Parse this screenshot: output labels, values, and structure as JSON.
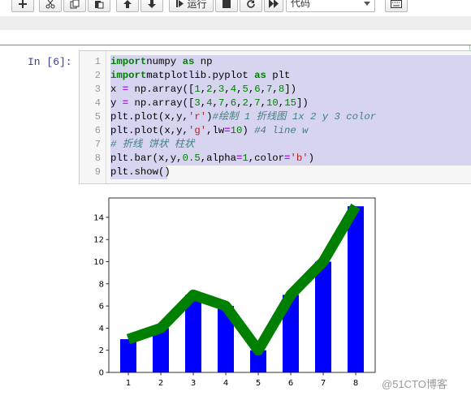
{
  "toolbar": {
    "run_label": "运行",
    "cell_type": "代码"
  },
  "cell": {
    "prompt": "In  [6]:",
    "lines": [
      {
        "no": "1",
        "tokens": [
          [
            "kw",
            "import"
          ],
          [
            "",
            "numpy "
          ],
          [
            "kw",
            "as"
          ],
          [
            "",
            " np"
          ]
        ]
      },
      {
        "no": "2",
        "tokens": [
          [
            "kw",
            "import"
          ],
          [
            "",
            "matplotlib.pyplot "
          ],
          [
            "kw",
            "as"
          ],
          [
            "",
            " plt"
          ]
        ]
      },
      {
        "no": "3",
        "tokens": [
          [
            "",
            "x "
          ],
          [
            "op",
            "="
          ],
          [
            "",
            " np.array(["
          ],
          [
            "num",
            "1"
          ],
          [
            "",
            ","
          ],
          [
            "num",
            "2"
          ],
          [
            "",
            ","
          ],
          [
            "num",
            "3"
          ],
          [
            "",
            ","
          ],
          [
            "num",
            "4"
          ],
          [
            "",
            ","
          ],
          [
            "num",
            "5"
          ],
          [
            "",
            ","
          ],
          [
            "num",
            "6"
          ],
          [
            "",
            ","
          ],
          [
            "num",
            "7"
          ],
          [
            "",
            ","
          ],
          [
            "num",
            "8"
          ],
          [
            "",
            "])"
          ]
        ]
      },
      {
        "no": "4",
        "tokens": [
          [
            "",
            "y "
          ],
          [
            "op",
            "="
          ],
          [
            "",
            " np.array(["
          ],
          [
            "num",
            "3"
          ],
          [
            "",
            ","
          ],
          [
            "num",
            "4"
          ],
          [
            "",
            ","
          ],
          [
            "num",
            "7"
          ],
          [
            "",
            ","
          ],
          [
            "num",
            "6"
          ],
          [
            "",
            ","
          ],
          [
            "num",
            "2"
          ],
          [
            "",
            ","
          ],
          [
            "num",
            "7"
          ],
          [
            "",
            ","
          ],
          [
            "num",
            "10"
          ],
          [
            "",
            ","
          ],
          [
            "num",
            "15"
          ],
          [
            "",
            "])"
          ]
        ]
      },
      {
        "no": "5",
        "tokens": [
          [
            "",
            "plt.plot(x,y,"
          ],
          [
            "str",
            "'r'"
          ],
          [
            "",
            ")"
          ],
          [
            "cm",
            "#绘制 1 折线图 1x 2 y 3 color"
          ]
        ]
      },
      {
        "no": "6",
        "tokens": [
          [
            "",
            "plt.plot(x,y,"
          ],
          [
            "str",
            "'g'"
          ],
          [
            "",
            ",lw"
          ],
          [
            "op",
            "="
          ],
          [
            "num",
            "10"
          ],
          [
            "",
            ") "
          ],
          [
            "cm",
            "#4 line w"
          ]
        ]
      },
      {
        "no": "7",
        "tokens": [
          [
            "cm",
            "# 折线 饼状 柱状"
          ]
        ]
      },
      {
        "no": "8",
        "tokens": [
          [
            "",
            "plt.bar(x,y,"
          ],
          [
            "num",
            "0.5"
          ],
          [
            "",
            ",alpha"
          ],
          [
            "op",
            "="
          ],
          [
            "num",
            "1"
          ],
          [
            "",
            ",color"
          ],
          [
            "op",
            "="
          ],
          [
            "str",
            "'b'"
          ],
          [
            "",
            ")"
          ]
        ]
      },
      {
        "no": "9",
        "tokens": [
          [
            "",
            "plt.show()"
          ]
        ]
      }
    ]
  },
  "chart_data": {
    "type": "bar",
    "x": [
      1,
      2,
      3,
      4,
      5,
      6,
      7,
      8
    ],
    "values": [
      3,
      4,
      7,
      6,
      2,
      7,
      10,
      15
    ],
    "bar_width": 0.5,
    "bar_color": "#0000ff",
    "line": {
      "x": [
        1,
        2,
        3,
        4,
        5,
        6,
        7,
        8
      ],
      "y": [
        3,
        4,
        7,
        6,
        2,
        7,
        10,
        15
      ],
      "color": "#008000"
    },
    "xticks": [
      "1",
      "2",
      "3",
      "4",
      "5",
      "6",
      "7",
      "8"
    ],
    "yticks": [
      "0",
      "2",
      "4",
      "6",
      "8",
      "10",
      "12",
      "14"
    ],
    "xlim": [
      0.4,
      8.6
    ],
    "ylim": [
      0,
      15.75
    ],
    "grid": false
  },
  "watermark": "@51CTO博客",
  "colors": {
    "accent": "#4caf50",
    "selection": "#d7d4f0"
  }
}
